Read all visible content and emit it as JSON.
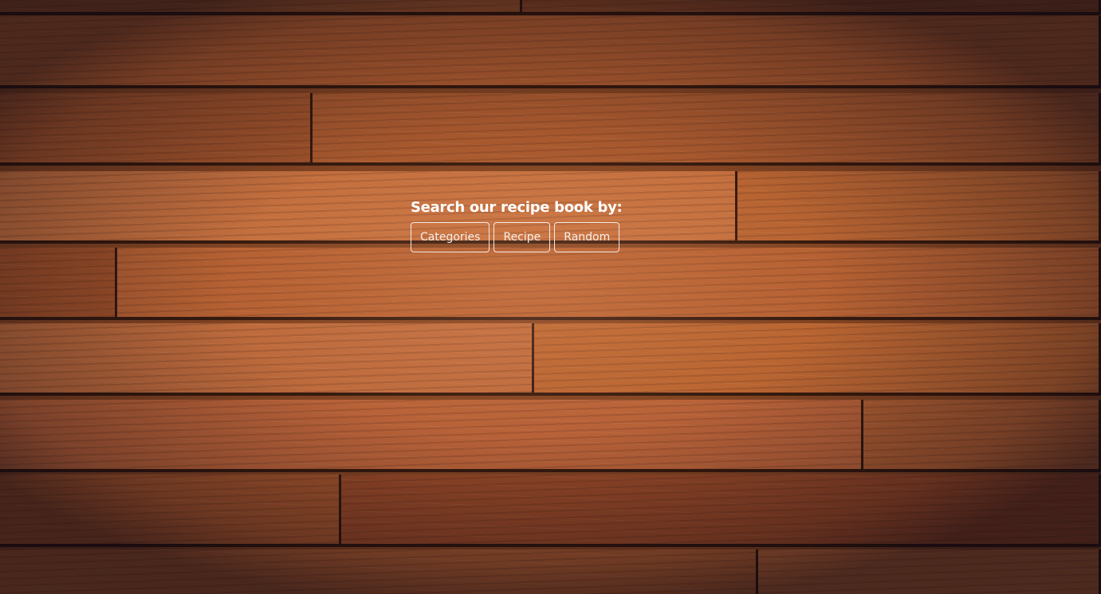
{
  "search": {
    "heading": "Search our recipe book by:",
    "buttons": [
      {
        "label": "Categories"
      },
      {
        "label": "Recipe"
      },
      {
        "label": "Random"
      }
    ]
  },
  "colors": {
    "wood_light": "#c7713f",
    "wood_mid": "#a8582c",
    "wood_dark": "#6e3318",
    "button_border": "#f4eae4",
    "text": "#ffffff"
  }
}
